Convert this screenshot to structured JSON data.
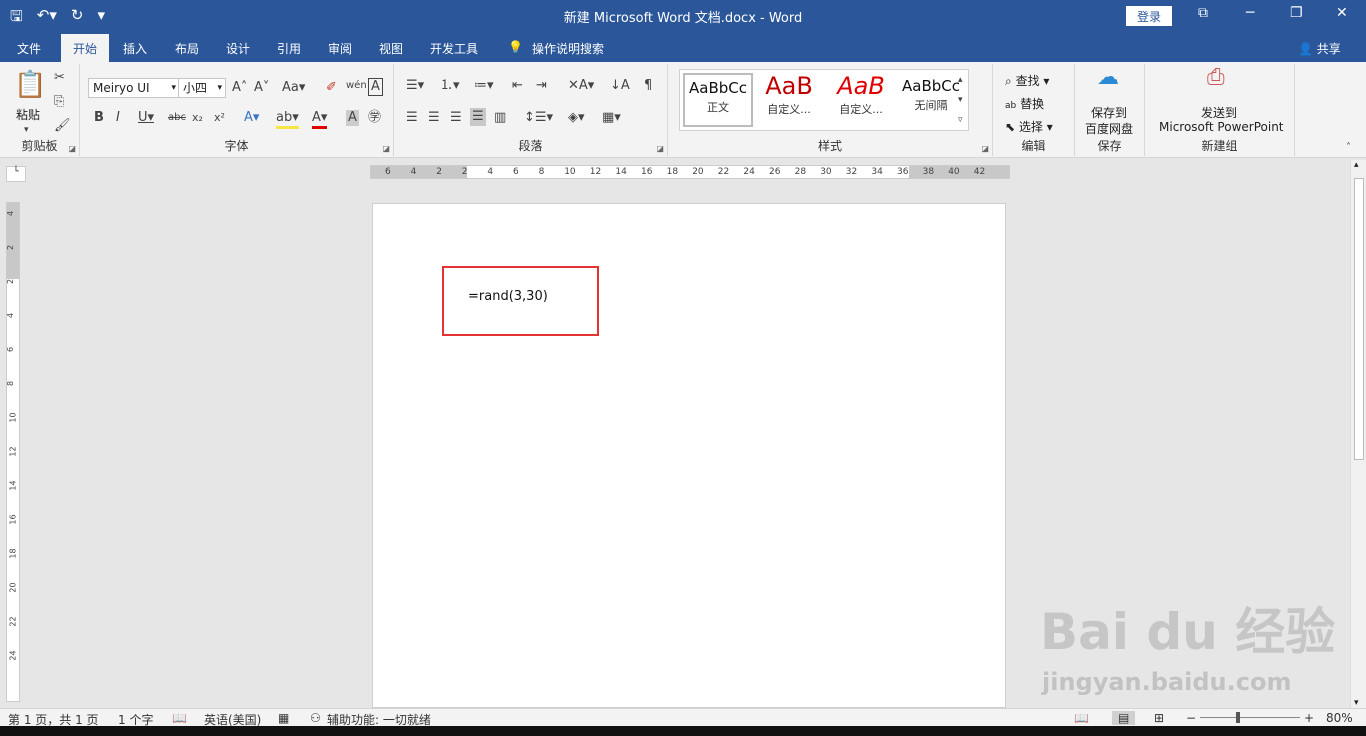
{
  "window": {
    "title": "新建 Microsoft Word 文档.docx  -  Word",
    "login": "登录",
    "share": "共享"
  },
  "tabs": [
    "文件",
    "开始",
    "插入",
    "布局",
    "设计",
    "引用",
    "审阅",
    "视图",
    "开发工具",
    "操作说明搜索"
  ],
  "ribbon": {
    "clipboard": {
      "label": "剪贴板",
      "paste": "粘贴"
    },
    "font": {
      "label": "字体",
      "name": "Meiryo UI",
      "size": "小四"
    },
    "paragraph": {
      "label": "段落"
    },
    "styles": {
      "label": "样式",
      "items": [
        {
          "preview": "AaBbCc",
          "name": "正文"
        },
        {
          "preview": "AaB",
          "name": "自定义..."
        },
        {
          "preview": "AaB",
          "name": "自定义..."
        },
        {
          "preview": "AaBbCc",
          "name": "无间隔"
        }
      ]
    },
    "editing": {
      "label": "编辑",
      "find": "查找",
      "replace": "替换",
      "select": "选择"
    },
    "save": {
      "label": "保存",
      "button": "保存到\n百度网盘",
      "line1": "保存到",
      "line2": "百度网盘"
    },
    "newgroup": {
      "label": "新建组",
      "line1": "发送到",
      "line2": "Microsoft PowerPoint"
    }
  },
  "ruler": {
    "h": [
      "6",
      "4",
      "2",
      "2",
      "4",
      "6",
      "8",
      "10",
      "12",
      "14",
      "16",
      "18",
      "20",
      "22",
      "24",
      "26",
      "28",
      "30",
      "32",
      "34",
      "36",
      "38",
      "40",
      "42"
    ],
    "v": [
      "4",
      "2",
      "2",
      "4",
      "6",
      "8",
      "10",
      "12",
      "14",
      "16",
      "18",
      "20",
      "22",
      "24"
    ]
  },
  "document": {
    "text": "=rand(3,30)"
  },
  "status": {
    "page": "第 1 页，共 1 页",
    "words": "1 个字",
    "lang": "英语(美国)",
    "access": "辅助功能: 一切就绪",
    "zoom": "80%"
  },
  "watermark": {
    "brand": "Bai du 经验",
    "url": "jingyan.baidu.com"
  },
  "colors": {
    "accent": "#2b579a",
    "highlight": "#e53333"
  }
}
